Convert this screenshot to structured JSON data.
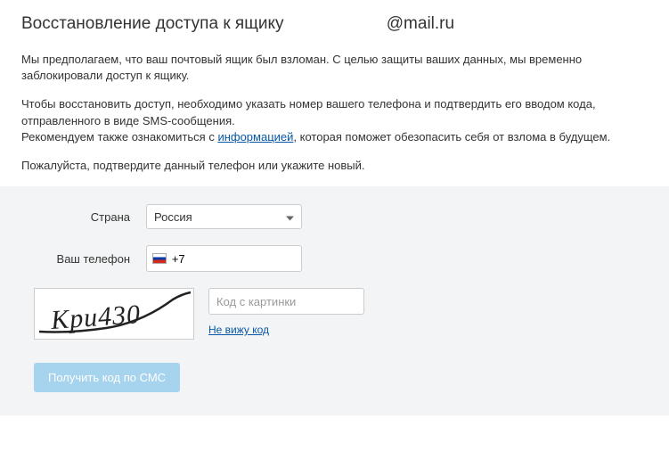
{
  "title_prefix": "Восстановление доступа к ящику",
  "title_email": "@mail.ru",
  "paragraphs": {
    "p1": "Мы предполагаем, что ваш почтовый ящик был взломан. С целью защиты ваших данных, мы временно заблокировали доступ к ящику.",
    "p2": "Чтобы восстановить доступ, необходимо указать номер вашего телефона и подтвердить его вводом кода, отправленного в виде SMS-сообщения.",
    "p3_before": "Рекомендуем также ознакомиться с ",
    "p3_link": "информацией",
    "p3_after": ", которая поможет обезопасить себя от взлома в будущем.",
    "p4": "Пожалуйста, подтвердите данный телефон или укажите новый."
  },
  "form": {
    "country_label": "Страна",
    "country_value": "Россия",
    "phone_label": "Ваш телефон",
    "phone_value": "+7",
    "captcha_placeholder": "Код с картинки",
    "captcha_refresh": "Не вижу код",
    "submit_label": "Получить код по СМС"
  },
  "captcha_text": "Kpu430"
}
